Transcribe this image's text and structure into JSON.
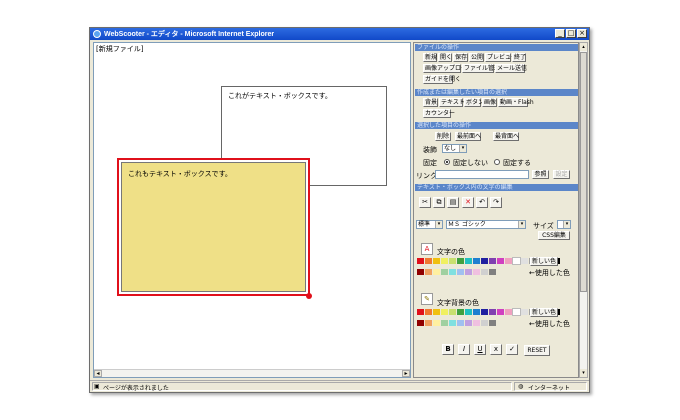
{
  "window": {
    "title": "WebScooter - エディタ - Microsoft Internet Explorer",
    "controls": {
      "minimize": "_",
      "maximize": "□",
      "close": "×"
    }
  },
  "editor": {
    "new_file_label": "[新規ファイル]",
    "textbox_plain": "これがテキスト・ボックスです。",
    "textbox_selected": "これもテキスト・ボックスです。"
  },
  "panel": {
    "file_ops": {
      "header": "ファイルの操作",
      "buttons": [
        "新規",
        "開く",
        "保存",
        "公開",
        "プレビュー",
        "終了",
        "画像アップロード",
        "ファイル管理",
        "メール送信",
        "ガイドを開く"
      ]
    },
    "create_edit": {
      "header": "作成または編集したい項目の選択",
      "buttons": [
        "背景",
        "テキスト",
        "ボタン",
        "画像",
        "動画・Flash",
        "カウンター"
      ]
    },
    "selected_item": {
      "header": "選択した項目の操作",
      "buttons": [
        "削除",
        "最前面へ",
        "最背面へ"
      ],
      "decoration_label": "装飾",
      "decoration_value": "なし",
      "fix_label": "固定",
      "fix_off": "固定しない",
      "fix_on": "固定する",
      "link_label": "リンク",
      "browse_button": "参照",
      "set_button": "設定"
    },
    "text_edit": {
      "header": "テキスト・ボックス内の文字の編集",
      "size_value": "標準",
      "font_value": "ＭＳ ゴシック",
      "size_label": "サイズ",
      "css_button": "CSS編集",
      "text_color_label": "文字の色",
      "new_color_button": "新しい色",
      "used_colors_label": "←使用した色",
      "bg_color_label": "文字背景の色",
      "new_color_button_2": "新しい色",
      "used_colors_label_2": "←使用した色",
      "format_buttons": [
        "B",
        "I",
        "U",
        "x",
        "✓"
      ],
      "reset_button": "RESET"
    }
  },
  "status": {
    "message": "ページが表示されました",
    "zone": "インターネット"
  },
  "colors": {
    "selection_border": "#e0101b",
    "textbox_fill": "#efe087",
    "section_header": "#5b86c9",
    "titlebar": "#1149c9"
  },
  "palette_row_1": [
    "#e0101b",
    "#f07830",
    "#f0c010",
    "#f0f060",
    "#c8e070",
    "#40a040",
    "#20c0c0",
    "#1e7fd0",
    "#2020a0",
    "#8040b0",
    "#d040c0",
    "#f0a0c0",
    "#ffffff",
    "#e0e0e0",
    "#a0a0a0",
    "#606060",
    "#202020",
    "#000000"
  ],
  "palette_row_2": [
    "#900000",
    "#f0a060",
    "#fff0a0",
    "#a0d0a0",
    "#80e0e0",
    "#a0c0f0",
    "#c0a0e0",
    "#f0c0e0",
    "#d0d0d0",
    "#808080"
  ],
  "palette_row_3": [
    "#e0101b",
    "#f07830",
    "#f0c010",
    "#f0f060",
    "#c8e070",
    "#40a040",
    "#20c0c0",
    "#1e7fd0",
    "#2020a0",
    "#8040b0",
    "#d040c0",
    "#f0a0c0",
    "#ffffff",
    "#e0e0e0",
    "#a0a0a0",
    "#606060",
    "#202020",
    "#000000"
  ],
  "palette_row_4": [
    "#900000",
    "#f0a060",
    "#fff0a0",
    "#a0d0a0",
    "#80e0e0",
    "#a0c0f0",
    "#c0a0e0",
    "#f0c0e0",
    "#d0d0d0",
    "#808080"
  ]
}
